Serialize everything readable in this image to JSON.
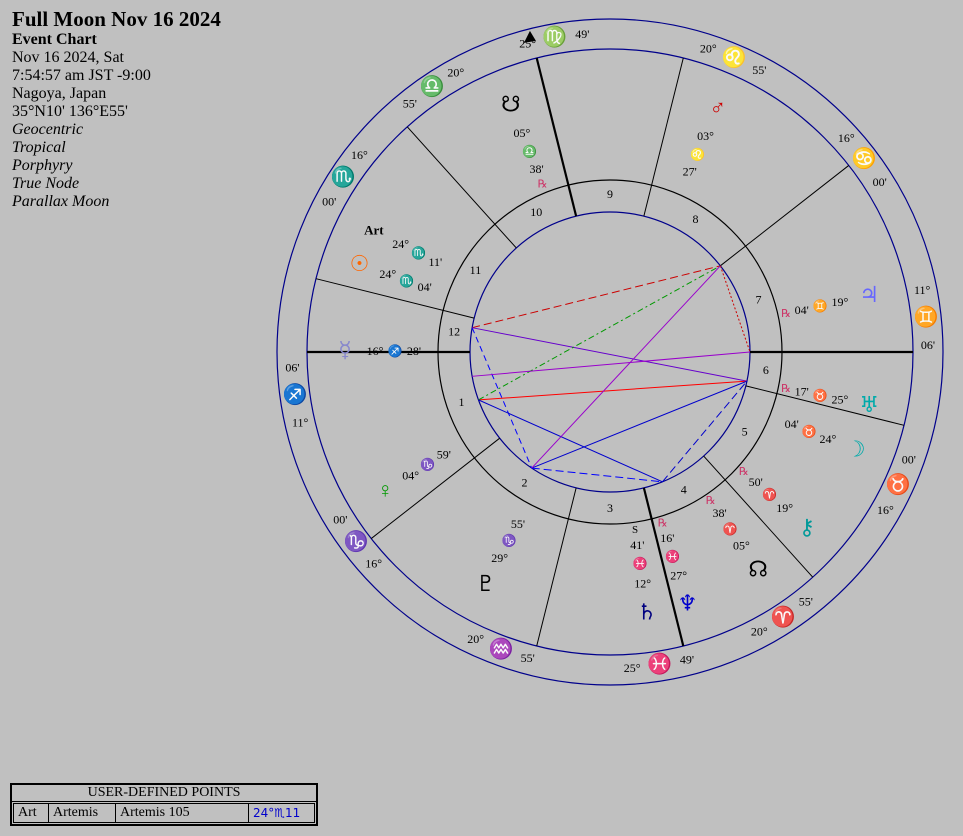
{
  "header": {
    "title": "Full Moon Nov 16 2024",
    "chart_type": "Event Chart",
    "date": "Nov 16 2024, Sat",
    "time": "7:54:57 am  JST -9:00",
    "place": "Nagoya, Japan",
    "coords": "35°N10' 136°E55'",
    "settings": [
      "Geocentric",
      "Tropical",
      "Porphyry",
      "True Node",
      "Parallax Moon"
    ]
  },
  "colors": {
    "background": "#c0c0c0",
    "ring": "#00008b",
    "aries_fire": "#cc0000",
    "earth": "#009900",
    "air": "#00aaaa",
    "water": "#000080"
  },
  "user_points": {
    "title": "USER-DEFINED POINTS",
    "rows": [
      {
        "abbr": "Art",
        "name": "Artemis",
        "desc": "Artemis 105",
        "pos": "24°♏11"
      }
    ]
  },
  "signs": [
    {
      "glyph": "♍",
      "color": "#009966",
      "deg_a": "25°",
      "deg_b": "49'",
      "icon": "virgo-icon"
    },
    {
      "glyph": "♌",
      "color": "#ff6600",
      "deg_a": "20°",
      "deg_b": "55'",
      "icon": "leo-icon"
    },
    {
      "glyph": "♋",
      "color": "#0000cc",
      "deg_a": "16°",
      "deg_b": "00'",
      "icon": "cancer-icon"
    },
    {
      "glyph": "♊",
      "color": "#00aaaa",
      "deg_a": "11°",
      "deg_b": "06'",
      "icon": "gemini-icon"
    },
    {
      "glyph": "♉",
      "color": "#009900",
      "deg_a": "00'",
      "deg_b": "16°",
      "icon": "taurus-icon"
    },
    {
      "glyph": "♈",
      "color": "#cc0000",
      "deg_a": "55'",
      "deg_b": "20°",
      "icon": "aries-icon"
    },
    {
      "glyph": "♓",
      "color": "#0000cc",
      "deg_a": "49'",
      "deg_b": "25°",
      "icon": "pisces-icon"
    },
    {
      "glyph": "♒",
      "color": "#00aaaa",
      "deg_a": "55'",
      "deg_b": "20°",
      "icon": "aquarius-icon"
    },
    {
      "glyph": "♑",
      "color": "#808080",
      "deg_a": "16°",
      "deg_b": "00'",
      "icon": "capricorn-icon"
    },
    {
      "glyph": "♐",
      "color": "#cc0066",
      "deg_a": "11°",
      "deg_b": "06'",
      "icon": "sagittarius-icon"
    },
    {
      "glyph": "♏",
      "color": "#0000cc",
      "deg_a": "00'",
      "deg_b": "16°",
      "icon": "scorpio-icon"
    },
    {
      "glyph": "♎",
      "color": "#00aaaa",
      "deg_a": "55'",
      "deg_b": "20°",
      "icon": "libra-icon"
    }
  ],
  "houses": [
    "1",
    "2",
    "3",
    "4",
    "5",
    "6",
    "7",
    "8",
    "9",
    "10",
    "11",
    "12"
  ],
  "planets": [
    {
      "name": "south-node",
      "glyph": "☋",
      "color": "#000000",
      "deg": "05°",
      "sign": "♎",
      "min": "38'",
      "retro": "℞"
    },
    {
      "name": "mars",
      "glyph": "♂",
      "color": "#cc0000",
      "deg": "03°",
      "sign": "♌",
      "min": "27'",
      "retro": ""
    },
    {
      "name": "jupiter",
      "glyph": "♃",
      "color": "#6666ff",
      "deg": "19°",
      "sign": "♊",
      "min": "04'",
      "retro": "℞"
    },
    {
      "name": "uranus",
      "glyph": "♅",
      "color": "#00aaaa",
      "deg": "25°",
      "sign": "♉",
      "min": "17'",
      "retro": "℞"
    },
    {
      "name": "moon",
      "glyph": "☽",
      "color": "#00aaaa",
      "deg": "24°",
      "sign": "♉",
      "min": "04'",
      "retro": ""
    },
    {
      "name": "chiron",
      "glyph": "⚷",
      "color": "#009999",
      "deg": "19°",
      "sign": "♈",
      "min": "50'",
      "retro": "℞"
    },
    {
      "name": "north-node",
      "glyph": "☊",
      "color": "#000000",
      "deg": "05°",
      "sign": "♈",
      "min": "38'",
      "retro": "℞"
    },
    {
      "name": "neptune",
      "glyph": "♆",
      "color": "#0000cc",
      "deg": "27°",
      "sign": "♓",
      "min": "16'",
      "retro": "℞"
    },
    {
      "name": "saturn",
      "glyph": "♄",
      "color": "#000080",
      "deg": "12°",
      "sign": "♓",
      "min": "41'",
      "retro": "S"
    },
    {
      "name": "pluto",
      "glyph": "♇",
      "color": "#000000",
      "deg": "29°",
      "sign": "♑",
      "min": "55'",
      "retro": ""
    },
    {
      "name": "venus",
      "glyph": "♀",
      "color": "#009900",
      "deg": "04°",
      "sign": "♑",
      "min": "59'",
      "retro": ""
    },
    {
      "name": "mercury",
      "glyph": "☿",
      "color": "#8888cc",
      "deg": "16°",
      "sign": "♐",
      "min": "28'",
      "retro": ""
    },
    {
      "name": "sun",
      "glyph": "☉",
      "color": "#ff6600",
      "deg": "24°",
      "sign": "♏",
      "min": "04'",
      "retro": ""
    },
    {
      "name": "artemis",
      "glyph": "Art",
      "color": "#000000",
      "deg": "24°",
      "sign": "♏",
      "min": "11'",
      "retro": ""
    }
  ]
}
